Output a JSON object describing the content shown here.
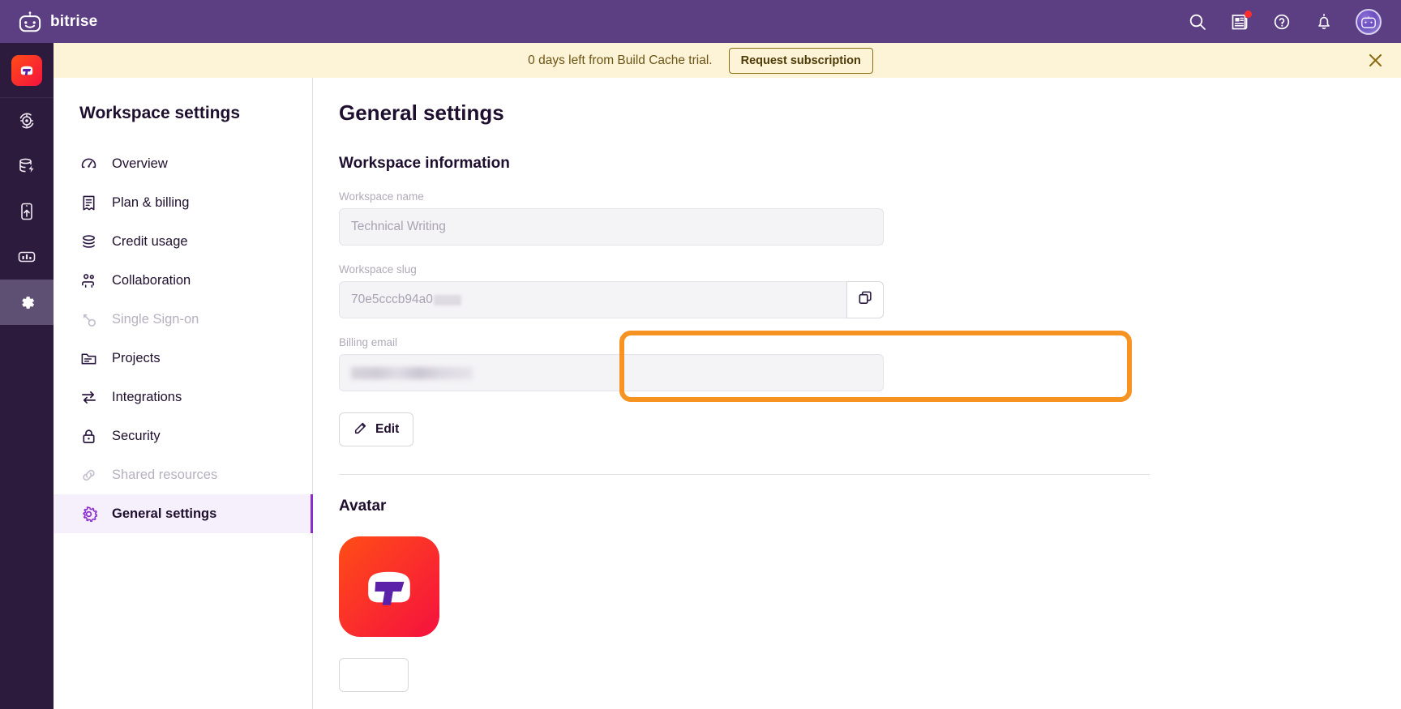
{
  "brand": {
    "name": "bitrise",
    "logo_icon": "bitrise-robot-icon"
  },
  "topbar": {
    "search_icon": "search-icon",
    "whats_new_icon": "whats-new-icon",
    "help_icon": "help-circle-icon",
    "notifications_icon": "bell-icon",
    "avatar_icon": "user-avatar"
  },
  "banner": {
    "message": "0 days left from Build Cache trial.",
    "cta_label": "Request subscription",
    "close_icon": "close-icon",
    "bg_color": "#fdf4d7",
    "text_color": "#6b5415"
  },
  "rail": {
    "workspace_avatar": "workspace-avatar-t",
    "items": [
      {
        "name": "ci-icon",
        "label": "CI/CD",
        "active": false
      },
      {
        "name": "build-cache-icon",
        "label": "Build Cache",
        "active": false
      },
      {
        "name": "release-management-icon",
        "label": "Release Management",
        "active": false
      },
      {
        "name": "insights-icon",
        "label": "Insights",
        "active": false
      },
      {
        "name": "settings-gear-icon",
        "label": "Settings",
        "active": true
      }
    ]
  },
  "sidebar": {
    "title": "Workspace settings",
    "items": [
      {
        "label": "Overview",
        "icon": "gauge-icon",
        "state": "normal"
      },
      {
        "label": "Plan & billing",
        "icon": "receipt-icon",
        "state": "normal"
      },
      {
        "label": "Credit usage",
        "icon": "coins-icon",
        "state": "normal"
      },
      {
        "label": "Collaboration",
        "icon": "users-icon",
        "state": "normal"
      },
      {
        "label": "Single Sign-on",
        "icon": "key-icon",
        "state": "disabled"
      },
      {
        "label": "Projects",
        "icon": "folder-icon",
        "state": "normal"
      },
      {
        "label": "Integrations",
        "icon": "arrows-swap-icon",
        "state": "normal"
      },
      {
        "label": "Security",
        "icon": "lock-icon",
        "state": "normal"
      },
      {
        "label": "Shared resources",
        "icon": "link-icon",
        "state": "disabled"
      },
      {
        "label": "General settings",
        "icon": "gear-icon",
        "state": "active"
      }
    ],
    "active_accent": "#8b2ccc",
    "active_bg": "#f6f0fd"
  },
  "main": {
    "page_title": "General settings",
    "section_title": "Workspace information",
    "fields": [
      {
        "label": "Workspace name",
        "value": "Technical Writing",
        "redacted": false
      },
      {
        "label": "Workspace slug",
        "value": "70e5cccb94a0",
        "redacted": true,
        "copy_icon": "copy-icon"
      },
      {
        "label": "Billing email",
        "value": "",
        "redacted": true
      }
    ],
    "edit_button": {
      "label": "Edit",
      "icon": "pencil-edit-icon"
    },
    "avatar_section": {
      "title": "Avatar",
      "avatar_icon": "workspace-avatar-t",
      "avatar_colors": [
        "#ff4d16",
        "#f5113f"
      ]
    },
    "highlight_color": "#f79421"
  }
}
